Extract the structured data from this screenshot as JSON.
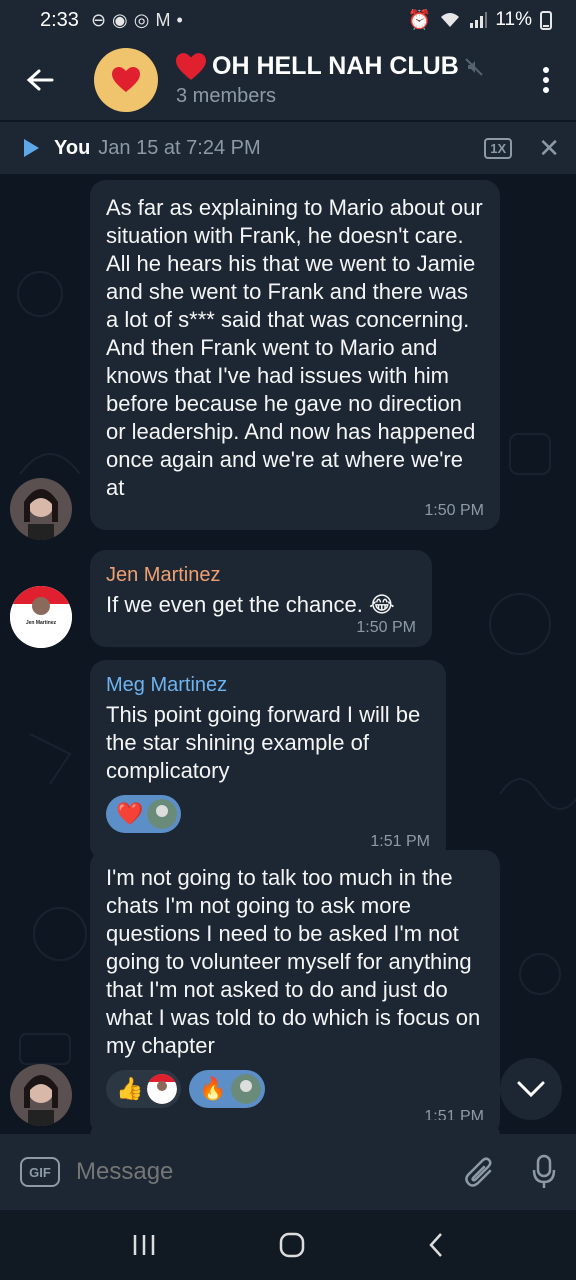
{
  "status_bar": {
    "time": "2:33",
    "battery": "11%"
  },
  "header": {
    "title": "OH HELL NAH CLUB",
    "members": "3 members"
  },
  "player": {
    "name": "You",
    "date": "Jan 15 at 7:24 PM",
    "speed": "1X"
  },
  "messages": [
    {
      "text": "As far as explaining to Mario about our situation with Frank, he doesn't care. All he hears his that we went to Jamie and she went to Frank and there was a lot of s*** said that was concerning. And then Frank went to Mario and knows that I've had issues with him before because he gave no direction or leadership. And now has happened once again and we're at where we're at",
      "time": "1:50 PM"
    },
    {
      "sender": "Jen Martinez",
      "text": "If we even get the chance. 😂",
      "time": "1:50 PM"
    },
    {
      "sender": "Meg Martinez",
      "text": "This point going forward I will be the star shining example of complicatory",
      "time": "1:51 PM",
      "reactions": [
        "❤️"
      ]
    },
    {
      "text": "I'm not going to talk too much in the chats I'm not going to ask more questions I need to be asked I'm not going to volunteer myself for anything that I'm not asked to do and just do what I was told to do which is focus on my chapter",
      "time": "1:51 PM",
      "reactions": [
        "👍",
        "🔥"
      ]
    }
  ],
  "jen_avatar_label": "Jen Martinez",
  "input": {
    "gif_label": "GIF",
    "placeholder": "Message"
  },
  "colors": {
    "background": "#0e1621",
    "bar": "#1c2733",
    "bubble": "#1d2733",
    "jen_name": "#f0a070",
    "meg_name": "#6fb3ee",
    "accent": "#5c8fc7"
  }
}
